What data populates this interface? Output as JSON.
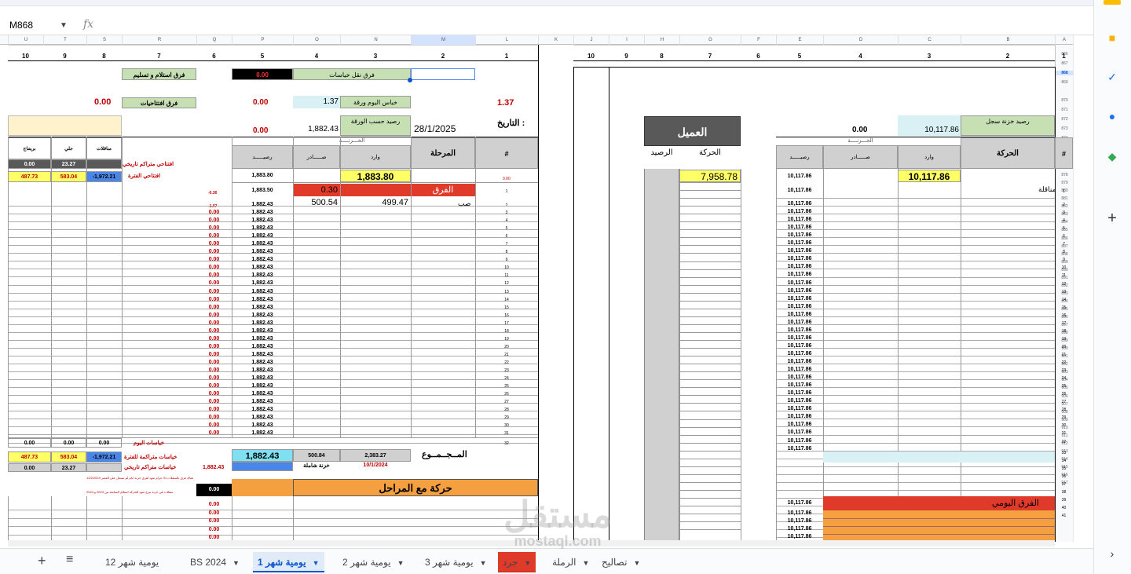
{
  "namebox": {
    "cell": "M868",
    "fx": "fx"
  },
  "col_headers_left": [
    "U",
    "T",
    "S",
    "R",
    "Q",
    "P",
    "O",
    "N",
    "M",
    "L"
  ],
  "col_headers_right": [
    "K",
    "J",
    "I",
    "H",
    "G",
    "F",
    "E",
    "D",
    "C",
    "B",
    "A"
  ],
  "num_row_left": [
    "10",
    "9",
    "8",
    "7",
    "6",
    "5",
    "4",
    "3",
    "2",
    "1"
  ],
  "num_row_right": [
    "10",
    "9",
    "8",
    "7",
    "6",
    "5",
    "4",
    "3",
    "2",
    "1"
  ],
  "left": {
    "farq_naql": "فرق نقل خياسات",
    "farq_naql_val": "0.00",
    "farq_istilam": "فرق استلام و تسليم",
    "khias_label": "خباس اليوم ورقة",
    "khias_val": "1.37",
    "khias_red": "1.37",
    "farq_iftitah": "فرق افتتاحيات",
    "farq_iftitah_val": "0.00",
    "farq_iftitah_val2": "0.00",
    "rased_label": "رصيد حسب الورقة",
    "rased_val": "1,882.43",
    "date_val": "28/1/2025",
    "date_label": "التاريخ :",
    "third_zero": "0.00",
    "khazna": "الخـــزنــــة",
    "hdr_rased": "رصيـــــد",
    "hdr_sader": "صـــــادر",
    "hdr_wared": "وارد",
    "hdr_marhala": "المرحلة",
    "hdr_hash": "#",
    "hdr_brintag": "بريتناج",
    "hdr_jali": "جلي",
    "hdr_munaq": "مناقلات",
    "iftitahi_tarikhi": "افتتاحي متراكم تاريخي",
    "iftitahi_fatra": "افتتاحي الفترة",
    "r0": [
      "0.00",
      "23.27"
    ],
    "r1": [
      "487.73",
      "583.04",
      "-1,972.21"
    ],
    "open_rased": "1,883.80",
    "open_wared": "1,883.80",
    "open_red": "0.00",
    "farq_label": "الفرق",
    "farq_sader": "0.30",
    "farq_rased": "1,883.50",
    "farq_side": "-0.30",
    "sabb_label": "صب",
    "sabb_sader": "500.54",
    "sabb_wared": "499.47",
    "sabb_rased": "1,882.43",
    "sabb_side": "-1.07",
    "rased_repeat": "1,882.43",
    "side_zero": "0.00",
    "khiasat_yom": "خياسات اليوم",
    "khiasat_yom_vals": [
      "0.00",
      "0.00",
      "0.00"
    ],
    "khiasat_fatra": "خياسات متراكمة للفترة",
    "khiasat_fatra_vals": [
      "487.73",
      "583.04",
      "-1,972.21"
    ],
    "khiasat_tarikhi": "خياسات متراكم تاريخي",
    "khiasat_tarikhi_vals": [
      "0.00",
      "23.27"
    ],
    "khiasat_tarikhi_red": "1,882.43",
    "total_rased": "1,882.43",
    "total_sader": "500.84",
    "total_wared": "2,383.27",
    "majmou": "المــجــمــوع",
    "khazna_shamila": "خزنة شاملة",
    "khazna_date": "10/1/2024",
    "note1": "هناك فرق بالمنقلات 31 جرام تعود لفرق خزنة ايام لم تسجل على العصر 12/2/2024",
    "note2": "منقلات في خزنة بيرج تعود للحركة استلام السابقة بين 2023 و 2024",
    "black_val": "0.00",
    "haraka_marahil": "حركة مع المراحل"
  },
  "right": {
    "rased_khazna": "رصيد خزنة سجل",
    "rased_khazna_val": "10,117.86",
    "zero": "0.00",
    "al_amil": "العميل",
    "khazna": "الخـــزنــــة",
    "hdr_haraka": "الحركة",
    "hdr_wared": "وارد",
    "hdr_sader": "صـــــادر",
    "hdr_rased": "رصيـــــد",
    "hdr_hash": "#",
    "hdr_haraka2": "الحركة",
    "hdr_rased2": "الرصيد",
    "open_wared": "10,117.86",
    "open_rased": "10,117.86",
    "client_val": "7,958.78",
    "munaqala": "مناقلة",
    "rased_repeat": "10,117.86",
    "farq_yawmi": "الفرق اليومي"
  },
  "rows_1_41": [
    "1",
    "2",
    "3",
    "4",
    "5",
    "6",
    "7",
    "8",
    "9",
    "10",
    "11",
    "12",
    "13",
    "14",
    "15",
    "16",
    "17",
    "18",
    "19",
    "20",
    "21",
    "22",
    "23",
    "24",
    "25",
    "26",
    "27",
    "28",
    "29",
    "30",
    "31",
    "32",
    "33",
    "34",
    "35",
    "36",
    "37",
    "38",
    "39",
    "40",
    "41"
  ],
  "row_headers": [
    "866",
    "867",
    "868",
    "869",
    "870",
    "871",
    "872",
    "873",
    "874",
    "875",
    "876",
    "877",
    "878",
    "879",
    "880",
    "881",
    "882",
    "883",
    "884",
    "885",
    "886",
    "887",
    "888",
    "889",
    "890",
    "891",
    "892",
    "893",
    "894",
    "895",
    "896",
    "897",
    "898",
    "899",
    "900",
    "901",
    "902",
    "903",
    "904",
    "905",
    "906",
    "907",
    "908",
    "909",
    "910",
    "911",
    "912",
    "913",
    "914",
    "915",
    "916",
    "917"
  ],
  "tabs": [
    {
      "label": "يومية شهر 12"
    },
    {
      "label": "BS 2024"
    },
    {
      "label": "يومية شهر 1"
    },
    {
      "label": "يومية شهر 2"
    },
    {
      "label": "يومية شهر 3"
    },
    {
      "label": "جرد"
    },
    {
      "label": "الرملة"
    },
    {
      "label": "تصاليح"
    }
  ],
  "watermark": {
    "main": "مستقل",
    "sub": "mostaql.com"
  },
  "colors": {
    "green": "#c6e0b4",
    "yellow": "#ffff66",
    "accent": "#0b57d0",
    "red": "#e03a2a",
    "orange": "#f4a040"
  }
}
